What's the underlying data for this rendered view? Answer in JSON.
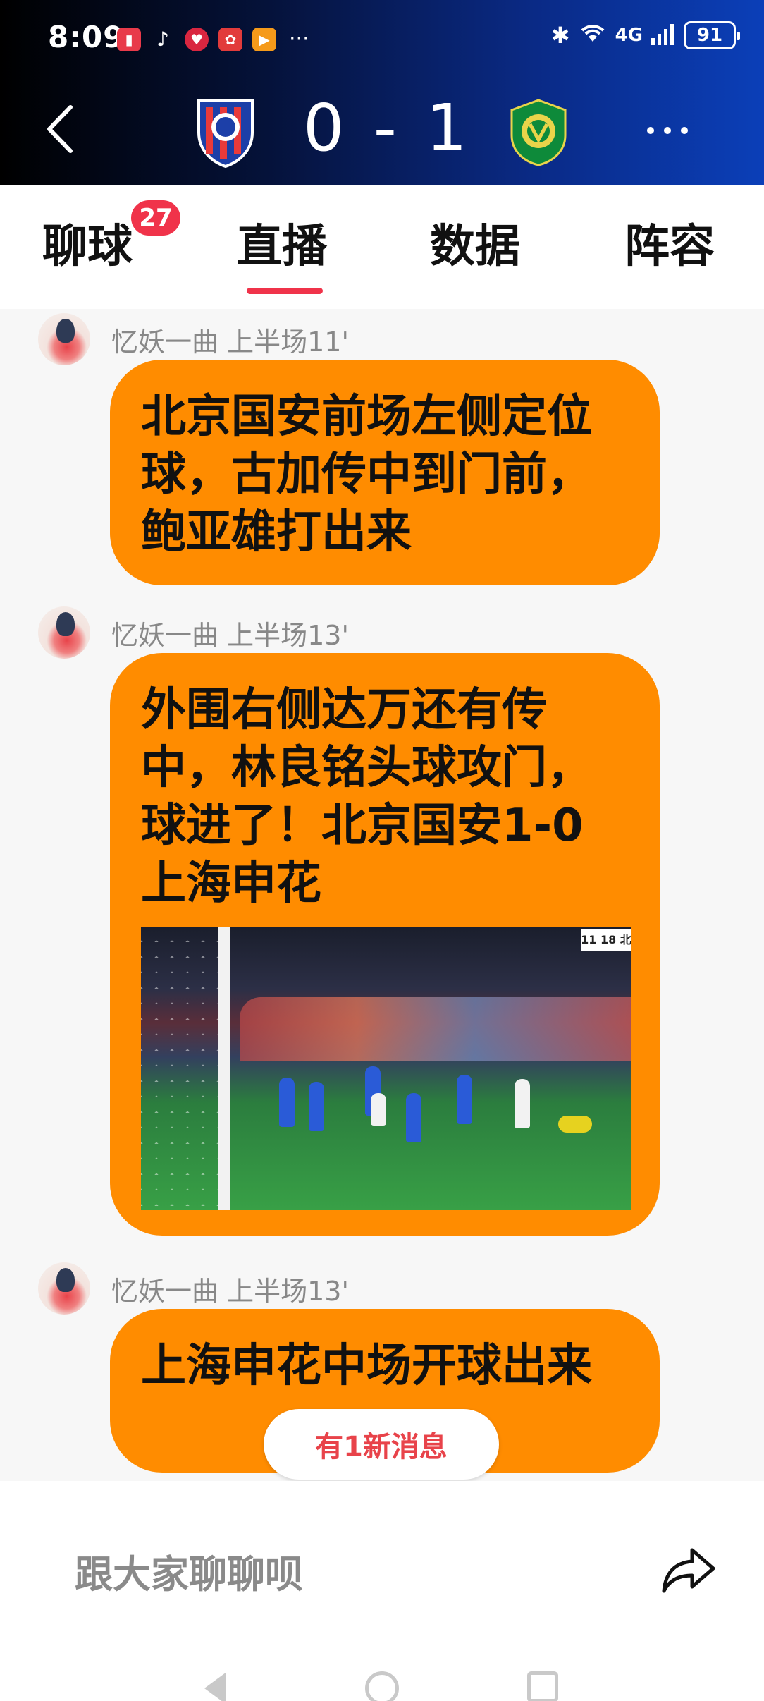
{
  "status_bar": {
    "time": "8:09",
    "app_icons": [
      "book-app-icon",
      "tiktok-icon",
      "heart-app-icon",
      "huawei-icon",
      "video-app-icon"
    ],
    "more": "···",
    "network": "4G",
    "battery": "91"
  },
  "match": {
    "home_team_crest": "shanghai-shenhua-crest",
    "away_team_crest": "beijing-guoan-crest",
    "score": "0 - 1"
  },
  "tabs": [
    {
      "label": "聊球",
      "badge": "27"
    },
    {
      "label": "直播",
      "active": true
    },
    {
      "label": "数据"
    },
    {
      "label": "阵容"
    }
  ],
  "messages": [
    {
      "user": "忆妖一曲",
      "time": "上半场11'",
      "text": "北京国安前场左侧定位球，古加传中到门前，鲍亚雄打出来"
    },
    {
      "user": "忆妖一曲",
      "time": "上半场13'",
      "text": "外围右侧达万还有传中，林良铭头球攻门，球进了！北京国安1-0上海申花",
      "has_image": true
    },
    {
      "user": "忆妖一曲",
      "time": "上半场13'",
      "text": "上海申花中场开球出来"
    }
  ],
  "new_message_pill": "有1新消息",
  "input": {
    "placeholder": "跟大家聊聊呗"
  },
  "colors": {
    "accent": "#f0334a",
    "bubble": "#ff8c00",
    "header_dark": "#000000",
    "header_blue": "#0b3fb8"
  }
}
